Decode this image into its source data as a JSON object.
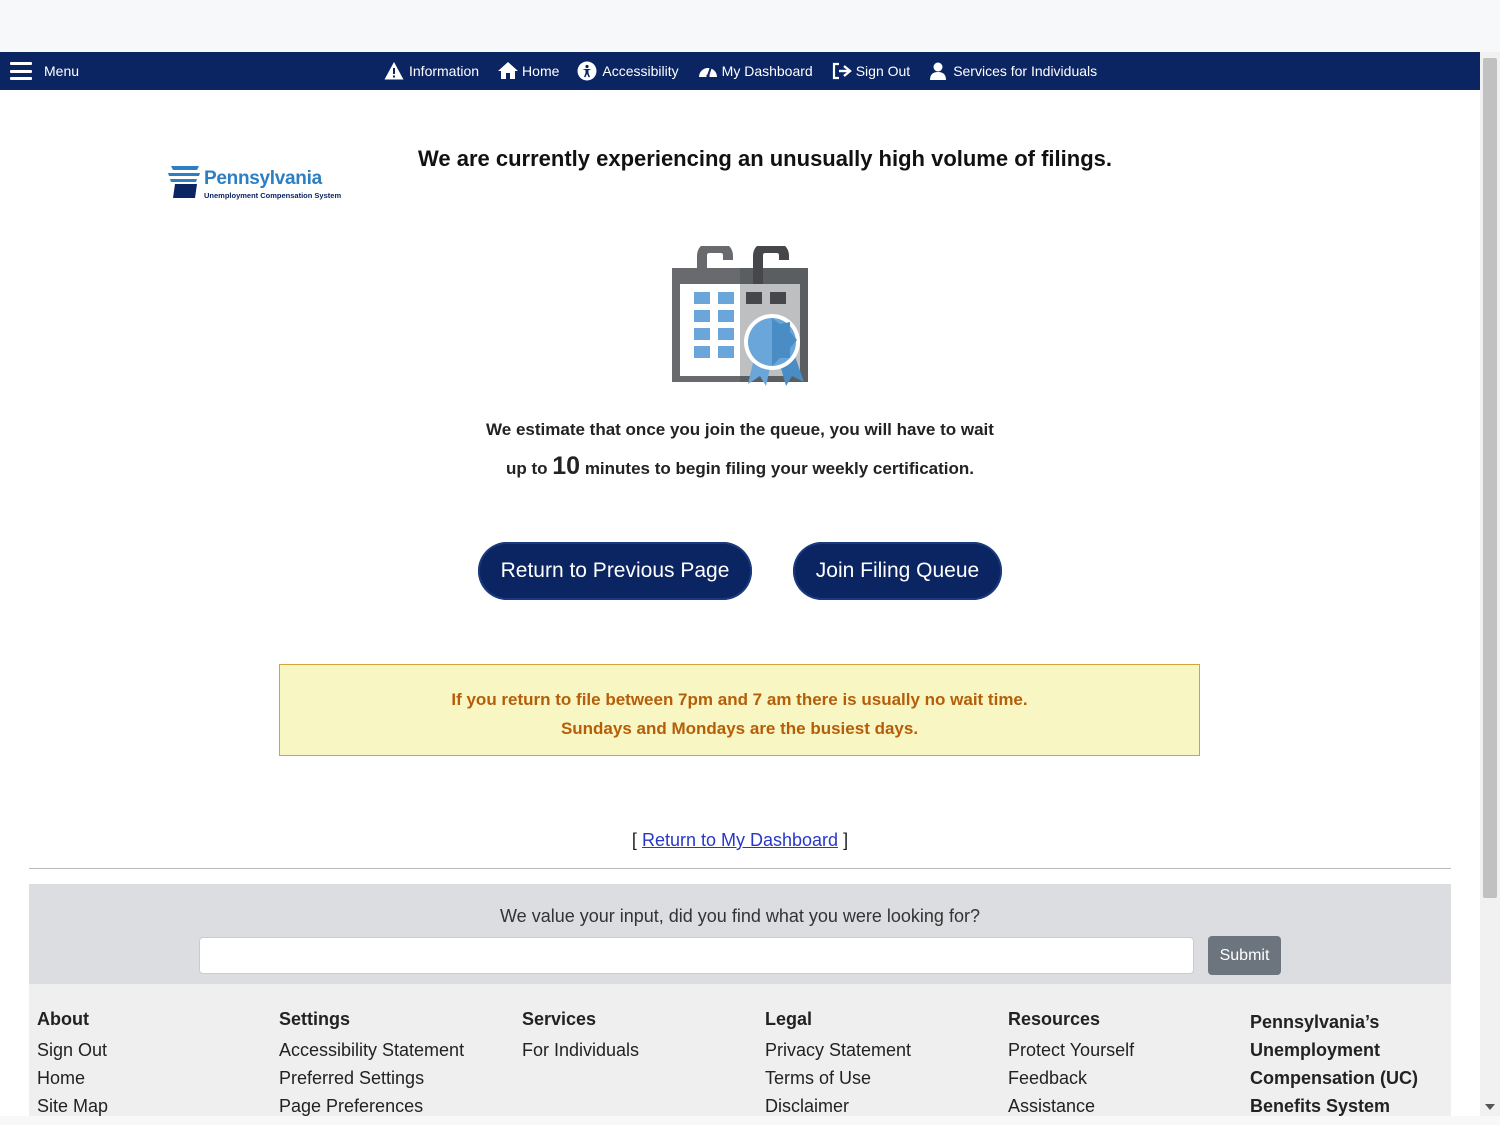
{
  "nav": {
    "menu_label": "Menu",
    "links": [
      {
        "label": "Information",
        "icon": "warning-icon"
      },
      {
        "label": "Home",
        "icon": "home-icon"
      },
      {
        "label": "Accessibility",
        "icon": "accessibility-icon"
      },
      {
        "label": "My Dashboard",
        "icon": "dashboard-icon"
      },
      {
        "label": "Sign Out",
        "icon": "sign-out-icon"
      },
      {
        "label": "Services for Individuals",
        "icon": "user-icon"
      }
    ]
  },
  "logo": {
    "name": "Pennsylvania",
    "subtitle": "Unemployment Compensation System"
  },
  "main": {
    "headline": "We are currently experiencing an unusually high volume of filings.",
    "estimate_line1": "We estimate that once you join the queue, you will have to wait",
    "estimate_prefix": "up to",
    "estimate_minutes": "10",
    "estimate_suffix": "minutes to begin filing your weekly certification.",
    "return_button": "Return to Previous Page",
    "join_button": "Join Filing Queue",
    "notice_line1": "If you return to file between 7pm and 7 am there is usually no wait time.",
    "notice_line2": "Sundays and Mondays are the busiest days.",
    "dashboard_open": "[",
    "dashboard_link": "Return to My Dashboard",
    "dashboard_close": "]"
  },
  "feedback": {
    "question": "We value your input, did you find what you were looking for?",
    "input_value": "",
    "submit_label": "Submit"
  },
  "footer": {
    "about": {
      "heading": "About",
      "items": [
        "Sign Out",
        "Home",
        "Site Map"
      ]
    },
    "settings": {
      "heading": "Settings",
      "items": [
        "Accessibility Statement",
        "Preferred Settings",
        "Page Preferences"
      ]
    },
    "services": {
      "heading": "Services",
      "items": [
        "For Individuals"
      ]
    },
    "legal": {
      "heading": "Legal",
      "items": [
        "Privacy Statement",
        "Terms of Use",
        "Disclaimer"
      ]
    },
    "resources": {
      "heading": "Resources",
      "items": [
        "Protect Yourself",
        "Feedback",
        "Assistance"
      ]
    },
    "brand_lines": [
      "Pennsylvania’s",
      "Unemployment",
      "Compensation (UC)",
      "Benefits System"
    ]
  },
  "colors": {
    "navbar": "#0b2462",
    "button": "#0b2462",
    "notice_bg": "#f8f6c2",
    "notice_text": "#b55e0a",
    "link": "#2738c9",
    "logo_blue": "#2d7fc4"
  }
}
